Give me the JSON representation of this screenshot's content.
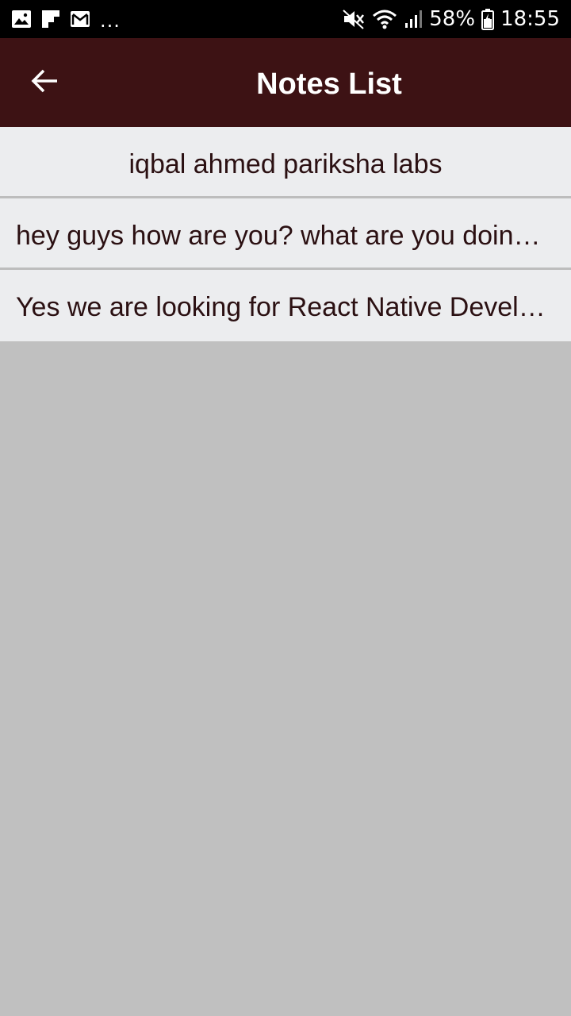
{
  "status_bar": {
    "notification_icons": [
      "image-icon",
      "flipboard-icon",
      "mail-icon"
    ],
    "more": "...",
    "system_icons": [
      "mute-icon",
      "wifi-icon",
      "signal-icon",
      "battery-icon"
    ],
    "battery": "58%",
    "time": "18:55"
  },
  "app_bar": {
    "back_icon": "arrow-left-icon",
    "title": "Notes List",
    "background": "#3d1214"
  },
  "notes": [
    {
      "text": "iqbal ahmed pariksha labs"
    },
    {
      "text": "hey guys how are you? what are you doing today?"
    },
    {
      "text": "Yes we are looking for React Native Developers"
    }
  ],
  "colors": {
    "list_background": "#c0c0c0",
    "item_background": "#ecedef",
    "item_text": "#2b1012"
  }
}
